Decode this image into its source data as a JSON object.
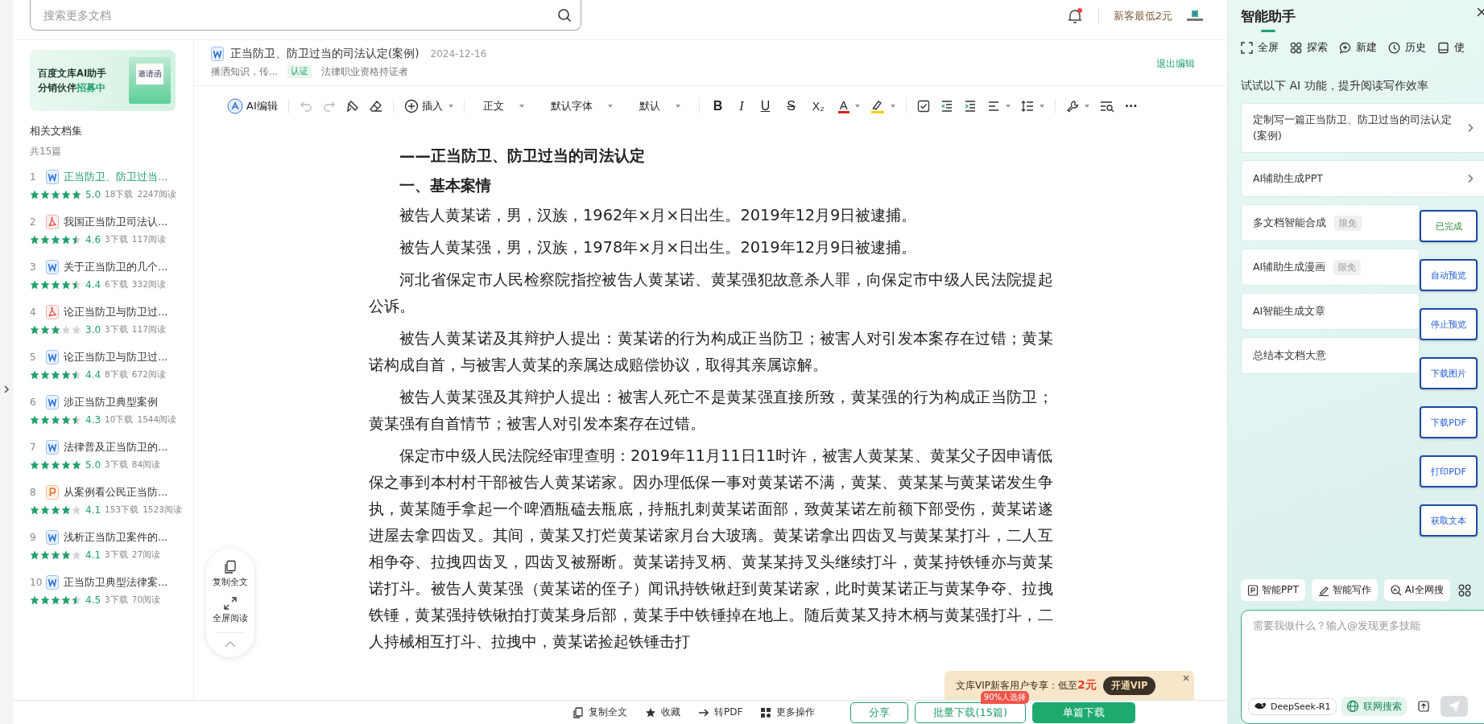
{
  "top_bar": {
    "search": {
      "placeholder": "搜索更多文档"
    },
    "bell_dot": true,
    "promo": "新客最低2元"
  },
  "sidebar": {
    "banner": {
      "line1": "百度文库AI助手",
      "line2": "分销伙伴**招募中**",
      "envelope": "邀请函"
    },
    "title": "相关文档集",
    "count": "共15篇",
    "items": [
      {
        "number": "1",
        "kind": "word",
        "title": "正当防卫、防卫过当...",
        "stars": 5,
        "rating": "5.0",
        "downloads": "18下载",
        "reads": "2247阅读",
        "selected": true
      },
      {
        "number": "2",
        "kind": "pdf",
        "title": "我国正当防卫司法认...",
        "stars": 4.5,
        "rating": "4.6",
        "downloads": "3下载",
        "reads": "117阅读",
        "selected": false
      },
      {
        "number": "3",
        "kind": "word",
        "title": "关于正当防卫的几个...",
        "stars": 4.5,
        "rating": "4.4",
        "downloads": "6下载",
        "reads": "332阅读",
        "selected": false
      },
      {
        "number": "4",
        "kind": "pdf",
        "title": "论正当防卫与防卫过...",
        "stars": 3,
        "rating": "3.0",
        "downloads": "3下载",
        "reads": "117阅读",
        "selected": false
      },
      {
        "number": "5",
        "kind": "word",
        "title": "论正当防卫与防卫过...",
        "stars": 4.5,
        "rating": "4.4",
        "downloads": "8下载",
        "reads": "672阅读",
        "selected": false
      },
      {
        "number": "6",
        "kind": "word",
        "title": "涉正当防卫典型案例",
        "stars": 4.5,
        "rating": "4.3",
        "downloads": "10下载",
        "reads": "1544阅读",
        "selected": false
      },
      {
        "number": "7",
        "kind": "word",
        "title": "法律普及正当防卫的...",
        "stars": 5,
        "rating": "5.0",
        "downloads": "3下载",
        "reads": "84阅读",
        "selected": false
      },
      {
        "number": "8",
        "kind": "ppt",
        "title": "从案例看公民正当防...",
        "stars": 4,
        "rating": "4.1",
        "downloads": "153下载",
        "reads": "1523阅读",
        "selected": false
      },
      {
        "number": "9",
        "kind": "word",
        "title": "浅析正当防卫案件的...",
        "stars": 4,
        "rating": "4.1",
        "downloads": "3下载",
        "reads": "27阅读",
        "selected": false
      },
      {
        "number": "10",
        "kind": "word",
        "title": "正当防卫典型法律案...",
        "stars": 4.5,
        "rating": "4.5",
        "downloads": "3下载",
        "reads": "70阅读",
        "selected": false
      }
    ]
  },
  "document": {
    "title": "正当防卫、防卫过当的司法认定(案例)",
    "date": "2024-12-16",
    "author": "播洒知识，传...",
    "badge": "认证",
    "author_role": "法律职业资格持证者",
    "exit_edit": "退出编辑"
  },
  "toolbar": {
    "ai_edit": "AI编辑",
    "insert": "插入",
    "style": "正文",
    "font": "默认字体",
    "size": "默认",
    "format": [
      {
        "kind": "bold",
        "label": "B"
      },
      {
        "kind": "italic",
        "label": "I"
      },
      {
        "kind": "underline",
        "label": "U"
      },
      {
        "kind": "strike",
        "label": "S"
      },
      {
        "kind": "subscript",
        "label": "X₂"
      }
    ],
    "font_color": "A",
    "more": "···"
  },
  "content": [
    {
      "kind": "heading",
      "text": "——正当防卫、防卫过当的司法认定"
    },
    {
      "kind": "heading",
      "text": "一、基本案情"
    },
    {
      "kind": "body",
      "text": "被告人黄某诺，男，汉族，1962年×月×日出生。2019年12月9日被逮捕。"
    },
    {
      "kind": "body",
      "text": "被告人黄某强，男，汉族，1978年×月×日出生。2019年12月9日被逮捕。"
    },
    {
      "kind": "body",
      "text": "河北省保定市人民检察院指控被告人黄某诺、黄某强犯故意杀人罪，向保定市中级人民法院提起公诉。"
    },
    {
      "kind": "body",
      "text": "被告人黄某诺及其辩护人提出：黄某诺的行为构成正当防卫；被害人对引发本案存在过错；黄某诺构成自首，与被害人黄某的亲属达成赔偿协议，取得其亲属谅解。"
    },
    {
      "kind": "body",
      "text": "被告人黄某强及其辩护人提出：被害人死亡不是黄某强直接所致，黄某强的行为构成正当防卫；黄某强有自首情节；被害人对引发本案存在过错。"
    },
    {
      "kind": "body",
      "text": "保定市中级人民法院经审理查明：2019年11月11日11时许，被害人黄某某、黄某父子因申请低保之事到本村村干部被告人黄某诺家。因办理低保一事对黄某诺不满，黄某、黄某某与黄某诺发生争执，黄某随手拿起一个啤酒瓶磕去瓶底，持瓶扎刺黄某诺面部，致黄某诺左前额下部受伤，黄某诺遂进屋去拿四齿叉。其间，黄某又打烂黄某诺家月台大玻璃。黄某诺拿出四齿叉与黄某某打斗，二人互相争夺、拉拽四齿叉，四齿叉被掰断。黄某诺持叉柄、黄某某持叉头继续打斗，黄某持铁锤亦与黄某诺打斗。被告人黄某强（黄某诺的侄子）闻讯持铁锹赶到黄某诺家，此时黄某诺正与黄某争夺、拉拽铁锤，黄某强持铁锹拍打黄某身后部，黄某手中铁锤掉在地上。随后黄某又持木柄与黄某强打斗，二人持械相互打斗、拉拽中，黄某诺捡起铁锤击打"
    }
  ],
  "float_tools": [
    "复制全文",
    "全屏阅读"
  ],
  "bottom_bar": {
    "actions": [
      "复制全文",
      "收藏",
      "转PDF",
      "更多操作"
    ],
    "share": "分享",
    "batch": "批量下载(15篇)",
    "batch_badge": "90%人选择",
    "single": "单篇下载"
  },
  "vip_popup": {
    "text": "文库VIP新客用户专享：低至**2元**",
    "button": "开通VIP"
  },
  "assistant": {
    "title": "智能助手",
    "nav": [
      "全屏",
      "探索",
      "新建",
      "历史",
      "使"
    ],
    "intro": "试试以下 AI 功能，提升阅读写作效率",
    "cards": [
      {
        "text": "定制写一篇正当防卫、防卫过当的司法认定(案例)",
        "arrow": true
      },
      {
        "text": "AI辅助生成PPT",
        "arrow": true
      },
      {
        "text": "多文档智能合成",
        "tag": "限免",
        "arrow": false
      },
      {
        "text": "AI辅助生成漫画",
        "tag": "限免",
        "arrow": false
      },
      {
        "text": "AI智能生成文章",
        "arrow": false
      },
      {
        "text": "总结本文档大意",
        "arrow": false
      }
    ],
    "chips": [
      "智能PPT",
      "智能写作",
      "AI全网搜"
    ],
    "input": {
      "placeholder": "需要我做什么？输入@发现更多技能"
    },
    "model": "DeepSeek-R1",
    "web_search": {
      "label": "联网搜索",
      "on": true
    }
  },
  "overlay_buttons": [
    {
      "label": "已完成",
      "kind": "status"
    },
    {
      "label": "自动预览",
      "kind": "action"
    },
    {
      "label": "停止预览",
      "kind": "action"
    },
    {
      "label": "下载图片",
      "kind": "action"
    },
    {
      "label": "下载PDF",
      "kind": "action"
    },
    {
      "label": "打印PDF",
      "kind": "action"
    },
    {
      "label": "获取文本",
      "kind": "action"
    }
  ]
}
